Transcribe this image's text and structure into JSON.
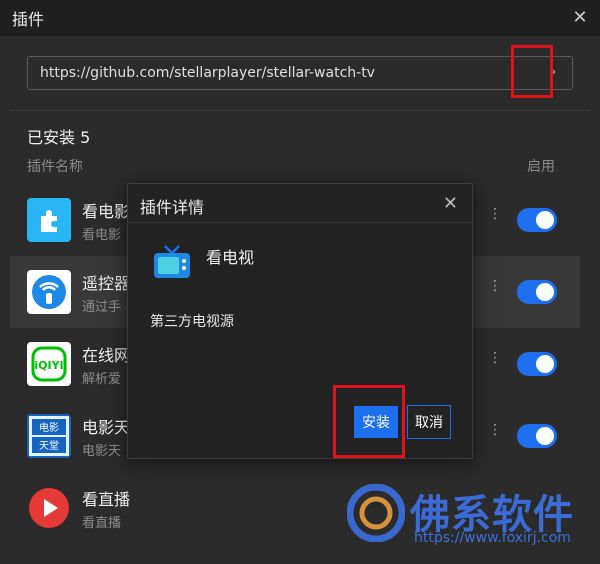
{
  "window": {
    "title": "插件",
    "close_icon": "close-icon"
  },
  "url_bar": {
    "value": "https://github.com/stellarplayer/stellar-watch-tv",
    "go_icon": "chevron-right-icon"
  },
  "list": {
    "installed_label": "已安装 5",
    "col_name": "插件名称",
    "col_enable": "启用",
    "items": [
      {
        "name": "看电影",
        "desc": "看电影",
        "icon": "puzzle-icon",
        "enabled": true
      },
      {
        "name": "遥控器",
        "desc": "通过手",
        "icon": "remote-icon",
        "enabled": true
      },
      {
        "name": "在线网",
        "desc": "解析爱",
        "icon": "iqiyi-icon",
        "enabled": true
      },
      {
        "name": "电影天",
        "desc": "电影天",
        "icon": "film-heaven-icon",
        "enabled": true
      },
      {
        "name": "看直播",
        "desc": "看直播",
        "icon": "play-icon",
        "enabled": true
      }
    ]
  },
  "dialog": {
    "title": "插件详情",
    "plugin_name": "看电视",
    "description": "第三方电视源",
    "install_label": "安装",
    "cancel_label": "取消"
  },
  "watermark": {
    "text": "佛系软件",
    "url": "https://www.foxirj.com"
  },
  "colors": {
    "accent": "#1e6ff0",
    "highlight": "#e0121b",
    "background": "#2b2b2b"
  }
}
